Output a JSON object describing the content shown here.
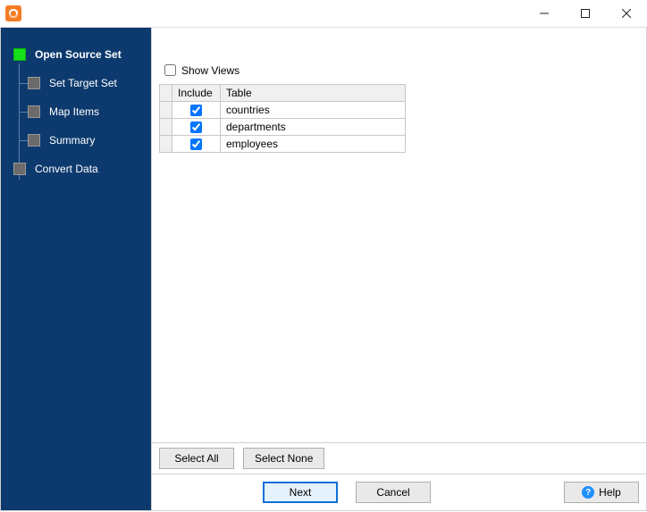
{
  "window": {
    "title": ""
  },
  "sidebar": {
    "steps": [
      {
        "label": "Open Source Set",
        "active": true,
        "child": false
      },
      {
        "label": "Set Target Set",
        "active": false,
        "child": true
      },
      {
        "label": "Map Items",
        "active": false,
        "child": true
      },
      {
        "label": "Summary",
        "active": false,
        "child": true
      },
      {
        "label": "Convert Data",
        "active": false,
        "child": false
      }
    ]
  },
  "main": {
    "show_views_label": "Show Views",
    "show_views_checked": false,
    "columns": {
      "include": "Include",
      "table": "Table"
    },
    "rows": [
      {
        "included": true,
        "table": "countries"
      },
      {
        "included": true,
        "table": "departments"
      },
      {
        "included": true,
        "table": "employees"
      }
    ],
    "select_all_label": "Select All",
    "select_none_label": "Select None"
  },
  "buttons": {
    "next": "Next",
    "cancel": "Cancel",
    "help": "Help"
  }
}
